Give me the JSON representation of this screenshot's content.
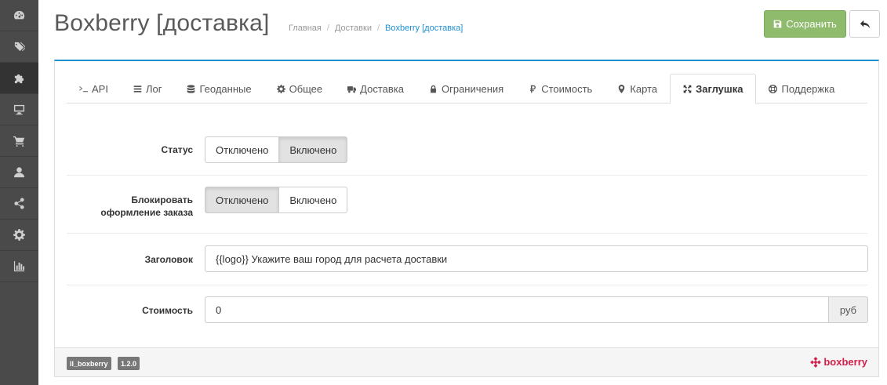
{
  "sidebar": {
    "items": [
      {
        "icon": "dashboard-icon"
      },
      {
        "icon": "tags-icon"
      },
      {
        "icon": "puzzle-icon"
      },
      {
        "icon": "desktop-icon"
      },
      {
        "icon": "cart-icon"
      },
      {
        "icon": "user-icon"
      },
      {
        "icon": "share-icon"
      },
      {
        "icon": "gear-icon"
      },
      {
        "icon": "bar-chart-icon"
      }
    ]
  },
  "header": {
    "title": "Boxberry [доставка]",
    "breadcrumb": [
      "Главная",
      "Доставки",
      "Boxberry [доставка]"
    ],
    "save_label": "Сохранить"
  },
  "tabs": [
    {
      "label": "API",
      "icon": "terminal-icon"
    },
    {
      "label": "Лог",
      "icon": "list-icon"
    },
    {
      "label": "Геоданные",
      "icon": "database-icon"
    },
    {
      "label": "Общее",
      "icon": "cog-icon"
    },
    {
      "label": "Доставка",
      "icon": "truck-icon"
    },
    {
      "label": "Ограничения",
      "icon": "lock-icon"
    },
    {
      "label": "Стоимость",
      "icon": "ruble-icon"
    },
    {
      "label": "Карта",
      "icon": "map-marker-icon"
    },
    {
      "label": "Заглушка",
      "icon": "expand-icon"
    },
    {
      "label": "Поддержка",
      "icon": "life-ring-icon"
    }
  ],
  "form": {
    "status": {
      "label": "Статус",
      "off": "Отключено",
      "on": "Включено",
      "selected": "on"
    },
    "block": {
      "label_line1": "Блокировать",
      "label_line2": "оформление заказа",
      "off": "Отключено",
      "on": "Включено",
      "selected": "off"
    },
    "heading": {
      "label": "Заголовок",
      "value": "{{logo}} Укажите ваш город для расчета доставки"
    },
    "cost": {
      "label": "Стоимость",
      "value": "0",
      "addon": "руб"
    }
  },
  "footer": {
    "module_badge": "ll_boxberry",
    "version_badge": "1.2.0",
    "logo_text": "boxberry"
  },
  "colors": {
    "accent": "#1e91cf",
    "save": "#8fbb6c",
    "brand": "#d21f4b",
    "sidebar": "#4a4a4a"
  }
}
